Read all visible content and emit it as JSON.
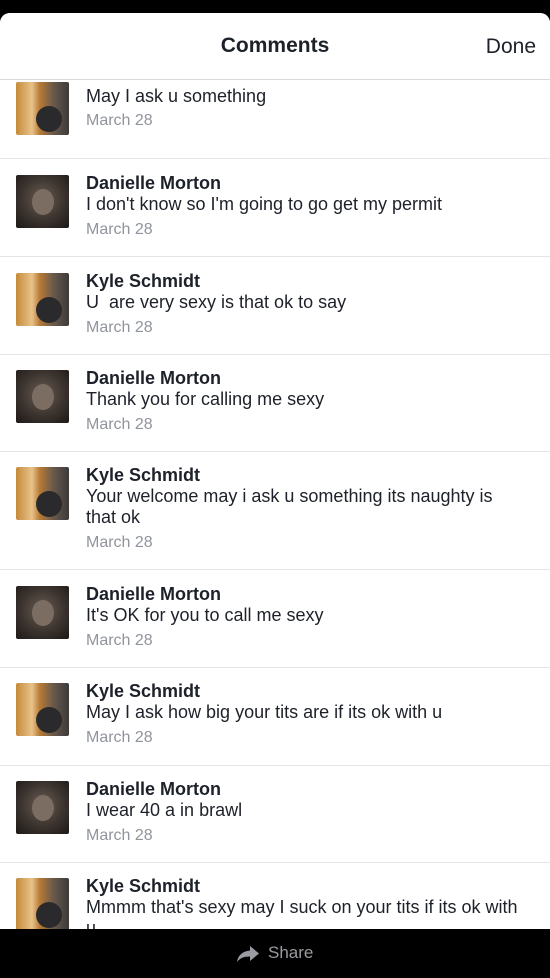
{
  "header": {
    "title": "Comments",
    "done_label": "Done"
  },
  "comments": [
    {
      "author": "",
      "text": "May I ask u something",
      "date": "March 28",
      "avatar": "kyle"
    },
    {
      "author": "Danielle Morton",
      "text": "I don't know so I'm going to go get my permit",
      "date": "March 28",
      "avatar": "danielle"
    },
    {
      "author": "Kyle Schmidt",
      "text": "U  are very sexy is that ok to say",
      "date": "March 28",
      "avatar": "kyle"
    },
    {
      "author": "Danielle Morton",
      "text": "Thank you for calling me sexy",
      "date": "March 28",
      "avatar": "danielle"
    },
    {
      "author": "Kyle Schmidt",
      "text": "Your welcome may i ask u something its naughty is that ok",
      "date": "March 28",
      "avatar": "kyle"
    },
    {
      "author": "Danielle Morton",
      "text": "It's OK for you to call me sexy",
      "date": "March 28",
      "avatar": "danielle"
    },
    {
      "author": "Kyle Schmidt",
      "text": "May I ask how big your tits are if its ok with u",
      "date": "March 28",
      "avatar": "kyle"
    },
    {
      "author": "Danielle Morton",
      "text": "I wear 40 a in brawl",
      "date": "March 28",
      "avatar": "danielle"
    },
    {
      "author": "Kyle Schmidt",
      "text": "Mmmm that's sexy may I suck on your tits if its ok with u",
      "date": "",
      "avatar": "kyle"
    }
  ],
  "footer": {
    "share_label": "Share"
  }
}
